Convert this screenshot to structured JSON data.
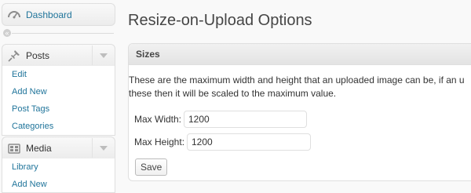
{
  "sidebar": {
    "dashboard": {
      "label": "Dashboard",
      "icon": "dashboard-icon"
    },
    "collapse_glyph": "«",
    "posts": {
      "label": "Posts",
      "icon": "pushpin-icon",
      "items": [
        {
          "label": "Edit"
        },
        {
          "label": "Add New"
        },
        {
          "label": "Post Tags"
        },
        {
          "label": "Categories"
        }
      ]
    },
    "media": {
      "label": "Media",
      "icon": "media-icon",
      "items": [
        {
          "label": "Library"
        },
        {
          "label": "Add New"
        }
      ]
    }
  },
  "main": {
    "title": "Resize-on-Upload Options",
    "box": {
      "title": "Sizes",
      "description_line1": "These are the maximum width and height that an uploaded image can be, if an u",
      "description_line2": "these then it will be scaled to the maximum value.",
      "width_label": "Max Width:",
      "width_value": "1200",
      "height_label": "Max Height:",
      "height_value": "1200",
      "save_label": "Save"
    }
  },
  "colors": {
    "link": "#21759b",
    "text": "#333333",
    "title": "#464646",
    "border": "#dfdfdf",
    "background": "#f9f9f9"
  }
}
